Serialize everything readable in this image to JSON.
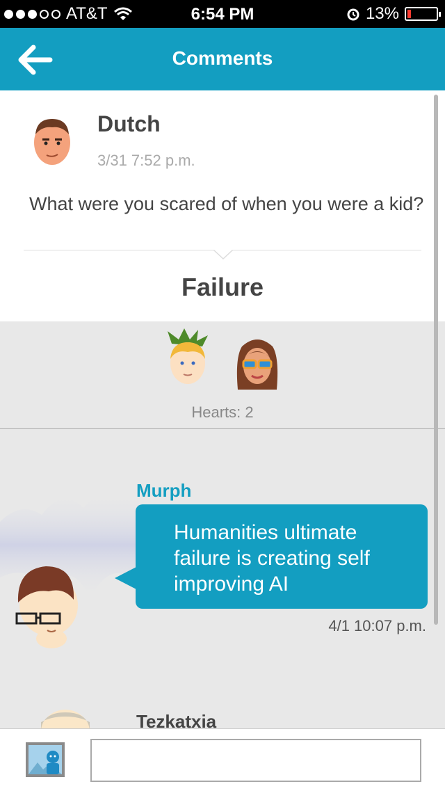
{
  "status_bar": {
    "carrier": "AT&T",
    "time": "6:54 PM",
    "battery_percent": "13%",
    "battery_level": 0.13,
    "signal_dots_filled": 3,
    "signal_dots_total": 5,
    "icons": [
      "wifi-icon",
      "alarm-icon",
      "battery-icon"
    ]
  },
  "header": {
    "title": "Comments",
    "back_icon": "back-arrow-icon"
  },
  "post": {
    "author": "Dutch",
    "timestamp": "3/31 7:52 p.m.",
    "question": "What were you scared of when you were a kid?",
    "answer": "Failure"
  },
  "hearts": {
    "label": "Hearts: 2",
    "count": 2
  },
  "comments": [
    {
      "author": "Murph",
      "text": "Humanities ultimate failure is creating self improving AI",
      "timestamp": "4/1 10:07 p.m."
    },
    {
      "author": "Tezkatxia"
    }
  ],
  "compose": {
    "image_button_icon": "image-icon",
    "placeholder": ""
  },
  "colors": {
    "accent": "#139ec1",
    "background": "#e8e8e8",
    "status_bar": "#000000",
    "battery_low": "#ff3b30"
  }
}
